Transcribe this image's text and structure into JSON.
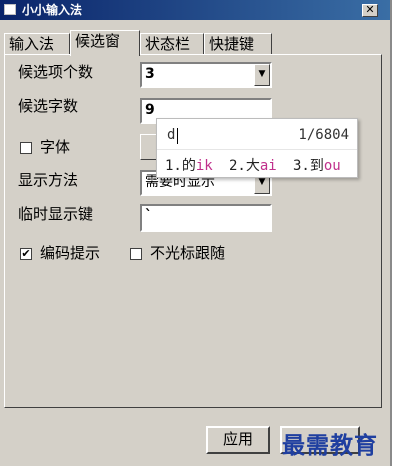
{
  "window": {
    "title": "小小输入法",
    "close_glyph": "✕"
  },
  "tabs": [
    {
      "label": "输入法"
    },
    {
      "label": "候选窗"
    },
    {
      "label": "状态栏"
    },
    {
      "label": "快捷键"
    }
  ],
  "form": {
    "candidate_count_label": "候选项个数",
    "candidate_count_value": "3",
    "candidate_chars_label": "候选字数",
    "candidate_chars_value": "9",
    "font_label": "字体",
    "display_method_label": "显示方法",
    "display_method_value": "需要时显示",
    "temp_display_key_label": "临时显示键",
    "temp_display_key_value": "`",
    "encoding_hint_label": "编码提示",
    "encoding_hint_checked": true,
    "cursor_follow_label": "不光标跟随",
    "cursor_follow_checked": false
  },
  "ime_popup": {
    "input": "d",
    "page": "1/6804",
    "candidates": [
      {
        "index": "1.",
        "char": "的",
        "code": "ik"
      },
      {
        "index": "2.",
        "char": "大",
        "code": "ai"
      },
      {
        "index": "3.",
        "char": "到",
        "code": "ou"
      }
    ]
  },
  "buttons": {
    "apply_label": "应用"
  },
  "watermark": "最需教育",
  "icons": {
    "dropdown_arrow": "chevron-down-icon",
    "check_mark": "✔"
  }
}
